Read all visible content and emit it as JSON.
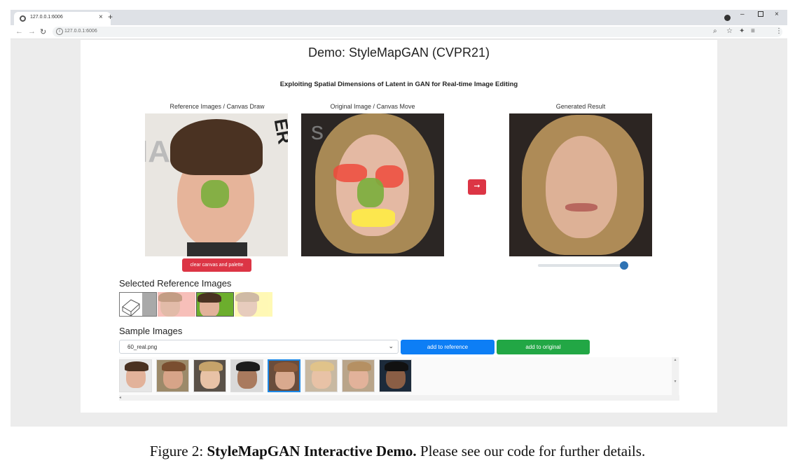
{
  "browser": {
    "tab_title": "127.0.0.1:6006",
    "tab_close": "×",
    "new_tab": "+",
    "url": "127.0.0.1:6006",
    "window_controls": {
      "minimize": "–",
      "close": "×"
    }
  },
  "page": {
    "title": "Demo: StyleMapGAN (CVPR21)",
    "subtitle": "Exploiting Spatial Dimensions of Latent in GAN for Real-time Image Editing",
    "columns": {
      "reference": "Reference Images / Canvas Draw",
      "original": "Original Image / Canvas Move",
      "result": "Generated Result"
    },
    "arrow_label": "➞",
    "clear_button": "clear canvas and palette",
    "slider_value": 1.0,
    "selected_heading": "Selected Reference Images",
    "selected_references": [
      {
        "name": "eraser",
        "palette_color": "#a9a9a9"
      },
      {
        "name": "face-woman-1",
        "palette_color": "#f5aaa2"
      },
      {
        "name": "face-man",
        "palette_color": "#6cae2d"
      },
      {
        "name": "face-woman-2",
        "palette_color": "#fff7a3"
      }
    ],
    "sample_heading": "Sample Images",
    "sample_select_value": "60_real.png",
    "add_reference_button": "add to reference",
    "add_original_button": "add to original",
    "sample_images_count": 8,
    "selected_sample_index": 4
  },
  "caption": {
    "prefix": "Figure 2: ",
    "bold": "StyleMapGAN Interactive Demo.",
    "rest": " Please see our code for further details."
  },
  "colors": {
    "red": "#dc3545",
    "blue": "#0d7ef5",
    "green": "#22a745",
    "slider": "#2f73b4"
  }
}
